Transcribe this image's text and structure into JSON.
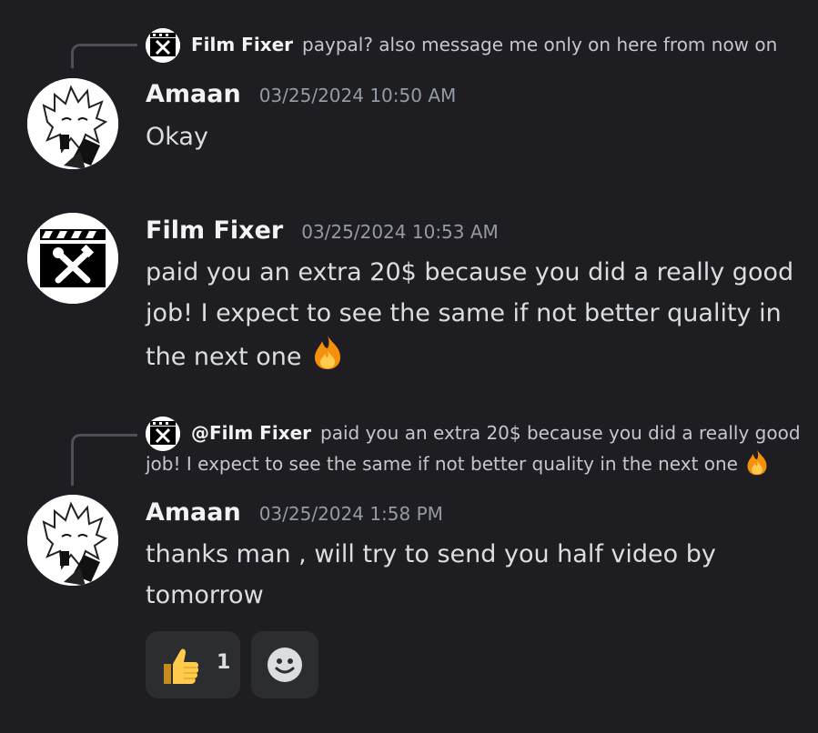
{
  "messages": [
    {
      "reply": {
        "author": "Film Fixer",
        "text": "paypal? also message me only on here from now on"
      },
      "author": "Amaan",
      "timestamp": "03/25/2024 10:50 AM",
      "lines": [
        "Okay"
      ]
    },
    {
      "author": "Film Fixer",
      "timestamp": "03/25/2024 10:53 AM",
      "lines": [
        "paid you an extra 20$ because you did a really good",
        "job! I expect to see the same if not better quality in",
        "the next one"
      ],
      "trailing_emoji": "fire-emoji"
    },
    {
      "reply": {
        "author": "@Film Fixer",
        "text_line1": "paid you an extra 20$ because you did a really good",
        "text_line2": "job! I expect to see the same if not better quality in the next one",
        "trailing_emoji": "fire-emoji"
      },
      "author": "Amaan",
      "timestamp": "03/25/2024 1:58 PM",
      "lines": [
        "thanks man , will try to send you half video by",
        "tomorrow"
      ],
      "reactions": [
        {
          "emoji": "thumbs-up-emoji",
          "count": "1"
        },
        {
          "emoji": "add-reaction-icon"
        }
      ]
    }
  ],
  "colors": {
    "background": "#1d1d22",
    "username": "#f2f3f5",
    "timestamp": "#949ba4",
    "text": "#dbdee1",
    "reaction_bg": "#2b2d31"
  }
}
